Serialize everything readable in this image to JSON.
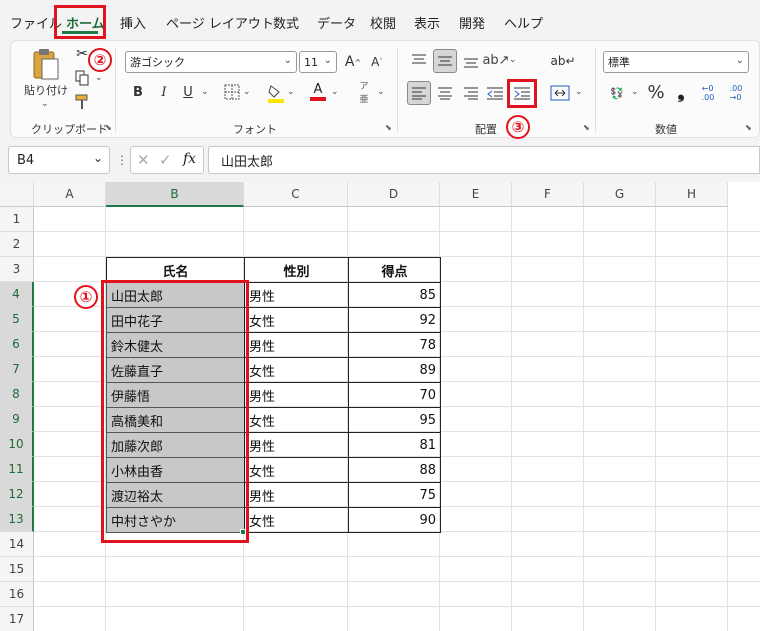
{
  "menu": [
    "ファイル",
    "ホーム",
    "挿入",
    "ページ レイアウト",
    "数式",
    "データ",
    "校閲",
    "表示",
    "開発",
    "ヘルプ"
  ],
  "ribbon": {
    "paste_label": "貼り付け",
    "font_name": "游ゴシック",
    "font_size": "11",
    "number_format": "標準",
    "bold": "B",
    "italic": "I",
    "underline": "U",
    "percent": "%",
    "groups": [
      "クリップボード",
      "フォント",
      "配置",
      "数値"
    ]
  },
  "formula_bar": {
    "name_box": "B4",
    "fx": "fx",
    "formula": "山田太郎"
  },
  "columns": [
    "A",
    "B",
    "C",
    "D",
    "E",
    "F",
    "G",
    "H"
  ],
  "rows": [
    "1",
    "2",
    "3",
    "4",
    "5",
    "6",
    "7",
    "8",
    "9",
    "10",
    "11",
    "12",
    "13",
    "14",
    "15",
    "16",
    "17"
  ],
  "table": {
    "headers": [
      "氏名",
      "性別",
      "得点"
    ],
    "rows": [
      [
        "山田太郎",
        "男性",
        "85"
      ],
      [
        "田中花子",
        "女性",
        "92"
      ],
      [
        "鈴木健太",
        "男性",
        "78"
      ],
      [
        "佐藤直子",
        "女性",
        "89"
      ],
      [
        "伊藤悟",
        "男性",
        "70"
      ],
      [
        "高橋美和",
        "女性",
        "95"
      ],
      [
        "加藤次郎",
        "男性",
        "81"
      ],
      [
        "小林由香",
        "女性",
        "88"
      ],
      [
        "渡辺裕太",
        "男性",
        "75"
      ],
      [
        "中村さやか",
        "女性",
        "90"
      ]
    ]
  },
  "annotations": [
    "①",
    "②",
    "③"
  ],
  "colors": {
    "accent": "#1e7b45",
    "annotation": "#e0141e",
    "selection": "#c8c8c8"
  }
}
